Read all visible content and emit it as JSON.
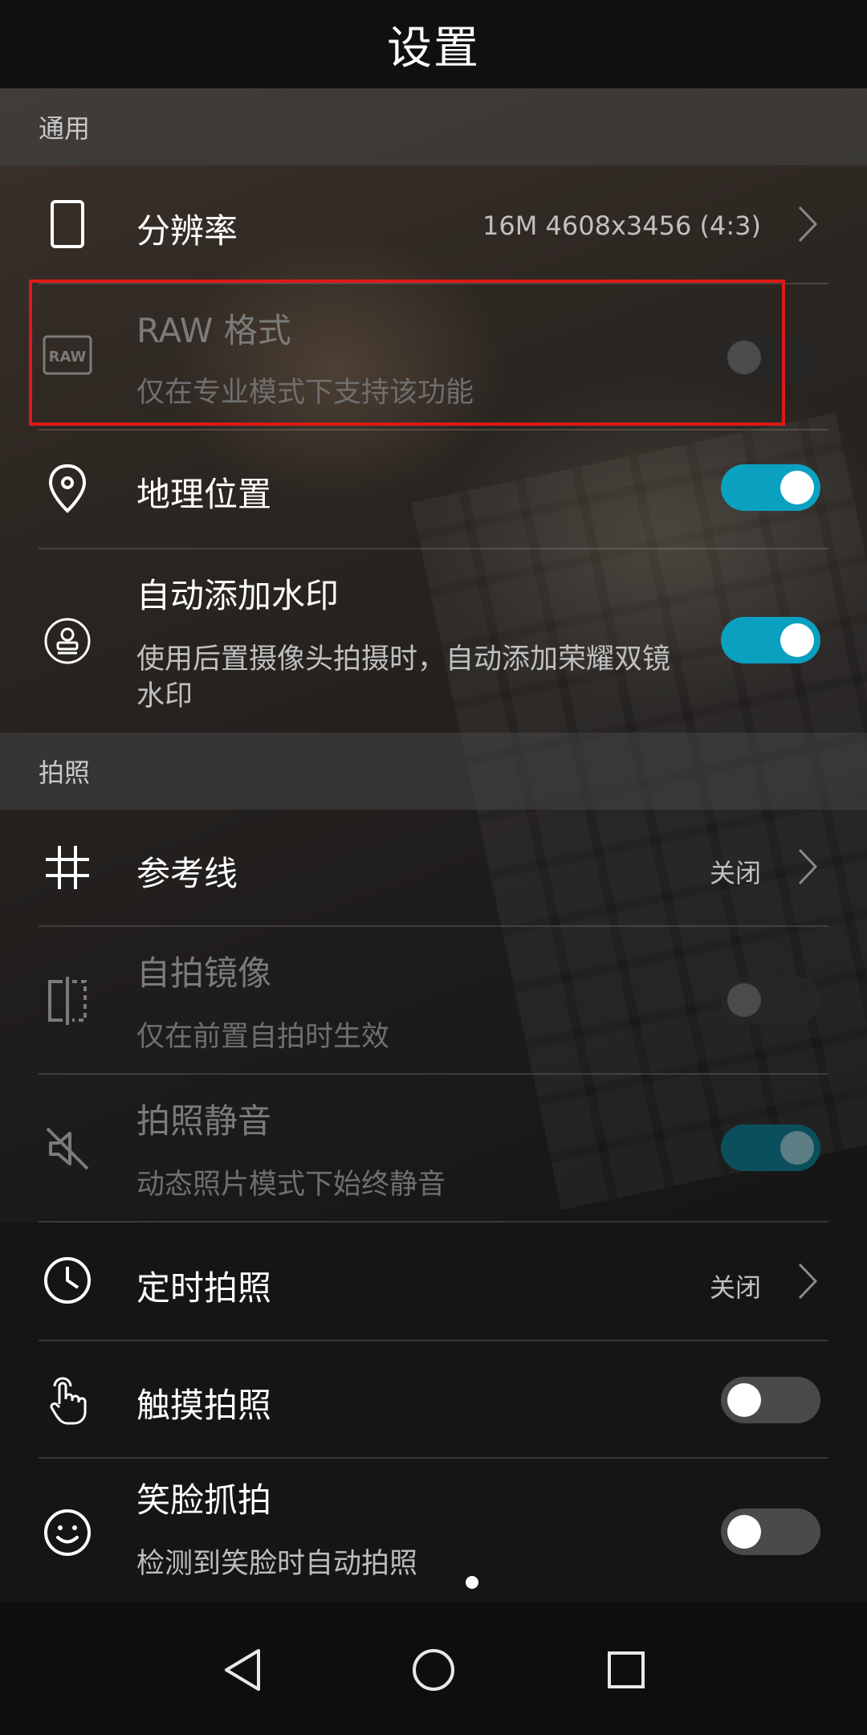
{
  "header": {
    "title": "设置"
  },
  "sections": {
    "general": "通用",
    "photo": "拍照"
  },
  "rows": {
    "resolution": {
      "label": "分辨率",
      "value": "16M 4608x3456 (4:3)",
      "icon": "phone-outline-icon"
    },
    "raw": {
      "label": "RAW 格式",
      "sub": "仅在专业模式下支持该功能",
      "icon": "raw-badge-icon",
      "enabled": false,
      "toggle_on": false
    },
    "location": {
      "label": "地理位置",
      "icon": "location-pin-icon",
      "toggle_on": true
    },
    "watermark": {
      "label": "自动添加水印",
      "sub": "使用后置摄像头拍摄时，自动添加荣耀双镜水印",
      "icon": "stamp-icon",
      "toggle_on": true
    },
    "gridlines": {
      "label": "参考线",
      "value": "关闭",
      "icon": "grid-icon"
    },
    "selfie_mirror": {
      "label": "自拍镜像",
      "sub": "仅在前置自拍时生效",
      "icon": "mirror-icon",
      "enabled": false,
      "toggle_on": false
    },
    "mute": {
      "label": "拍照静音",
      "sub": "动态照片模式下始终静音",
      "icon": "mute-speaker-icon",
      "enabled": false,
      "toggle_on": true
    },
    "timer": {
      "label": "定时拍照",
      "value": "关闭",
      "icon": "clock-icon"
    },
    "touch": {
      "label": "触摸拍照",
      "icon": "touch-hand-icon",
      "toggle_on": false
    },
    "smile": {
      "label": "笑脸抓拍",
      "sub": "检测到笑脸时自动拍照",
      "icon": "smile-face-icon",
      "toggle_on": false
    }
  },
  "nav": {
    "back": "back-triangle-icon",
    "home": "home-circle-icon",
    "recents": "recents-square-icon"
  },
  "colors": {
    "accent": "#0aa0c0",
    "highlight": "#e01818"
  }
}
